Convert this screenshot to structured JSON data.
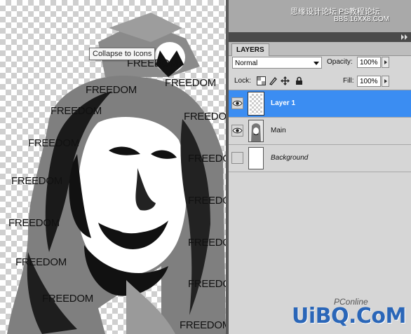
{
  "canvas": {
    "overlay_text": [
      "FREEDOM",
      "FREEDOM",
      "FREEDOM",
      "FREEDOM",
      "FREEDOM",
      "FREEDOM",
      "FREEDOM",
      "FREEDOM",
      "FREEDOM",
      "FREEDOM",
      "FREEDOM",
      "FREEDOM",
      "FREEDOM",
      "FREEDOM",
      "FREEDOM"
    ]
  },
  "watermark": {
    "line1": "思缘设计论坛  PS教程论坛",
    "line2": "BBS.16XX8.COM"
  },
  "panel": {
    "tab_label": "LAYERS",
    "tooltip": "Collapse to Icons",
    "blend_mode": "Normal",
    "opacity_label": "Opacity:",
    "opacity_value": "100%",
    "lock_label": "Lock:",
    "fill_label": "Fill:",
    "fill_value": "100%"
  },
  "layers": [
    {
      "name": "Layer 1",
      "selected": true,
      "visible": true
    },
    {
      "name": "Main",
      "selected": false,
      "visible": true
    },
    {
      "name": "Background",
      "selected": false,
      "visible": false
    }
  ],
  "branding": {
    "logo": "UiBQ.CoM",
    "sub": "PConline"
  },
  "colors": {
    "selection": "#3b8df2",
    "panel_bg": "#d6d6d6",
    "logo": "#2a66b8"
  }
}
